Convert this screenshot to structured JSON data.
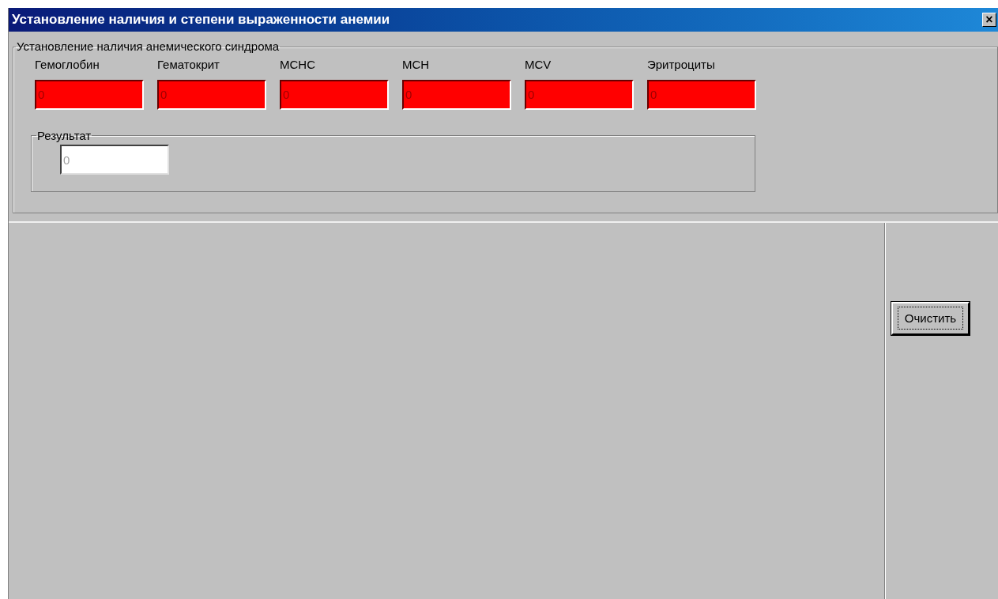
{
  "window": {
    "title": "Установление наличия и степени выраженности анемии",
    "close": "×"
  },
  "group": {
    "title": "Установление наличия анемического синдрома",
    "fields": [
      {
        "label": "Гемоглобин",
        "value": "0",
        "invalid": true
      },
      {
        "label": "Гематокрит",
        "value": "0",
        "invalid": true
      },
      {
        "label": "MCHC",
        "value": "0",
        "invalid": true
      },
      {
        "label": "MCH",
        "value": "0",
        "invalid": true
      },
      {
        "label": "MCV",
        "value": "0",
        "invalid": true
      },
      {
        "label": "Эритроциты",
        "value": "0",
        "invalid": true
      }
    ],
    "result": {
      "title": "Результат",
      "value": "0",
      "disabled": true
    }
  },
  "buttons": [
    {
      "label": "Очистить",
      "focused": true
    }
  ]
}
